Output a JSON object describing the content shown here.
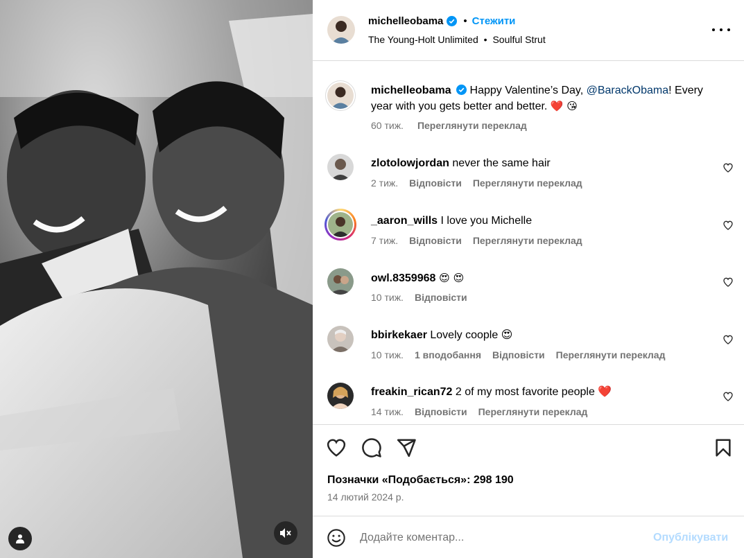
{
  "header": {
    "username": "michelleobama",
    "separator": "•",
    "follow_label": "Стежити",
    "audio_artist": "The Young-Holt Unlimited",
    "audio_sep": "•",
    "audio_track": "Soulful Strut"
  },
  "caption": {
    "username": "michelleobama",
    "text_before": " Happy Valentine’s Day, ",
    "mention": "@BarackObama",
    "text_after": "! Every year with you gets better and better. ",
    "emoji": "❤️ 😘",
    "time": "60 тиж.",
    "translate": "Переглянути переклад"
  },
  "comments": [
    {
      "username": "zlotolowjordan",
      "text": " never the same hair",
      "time": "2 тиж.",
      "reply": "Відповісти",
      "translate": "Переглянути переклад"
    },
    {
      "username": "_aaron_wills",
      "text": " I love you Michelle",
      "time": "7 тиж.",
      "reply": "Відповісти",
      "translate": "Переглянути переклад"
    },
    {
      "username": "owl.8359968",
      "text": " 😍 😍",
      "time": "10 тиж.",
      "reply": "Відповісти"
    },
    {
      "username": "bbirkekaer",
      "text": " Lovely coople 😍",
      "time": "10 тиж.",
      "likes": "1 вподобання",
      "reply": "Відповісти",
      "translate": "Переглянути переклад"
    },
    {
      "username": "freakin_rican72",
      "text": " 2 of my most favorite people ❤️",
      "time": "14 тиж.",
      "reply": "Відповісти",
      "translate": "Переглянути переклад"
    }
  ],
  "actions": {
    "likes_label": "Позначки «Подобається»: 298 190",
    "date": "14 лютий 2024 р."
  },
  "comment_box": {
    "placeholder": "Додайте коментар...",
    "publish_label": "Опублікувати"
  },
  "colors": {
    "accent": "#0095f6",
    "publish_disabled": "#b3dbff",
    "secondary_text": "#737373",
    "border": "#dbdbdb",
    "mention": "#00376b"
  }
}
